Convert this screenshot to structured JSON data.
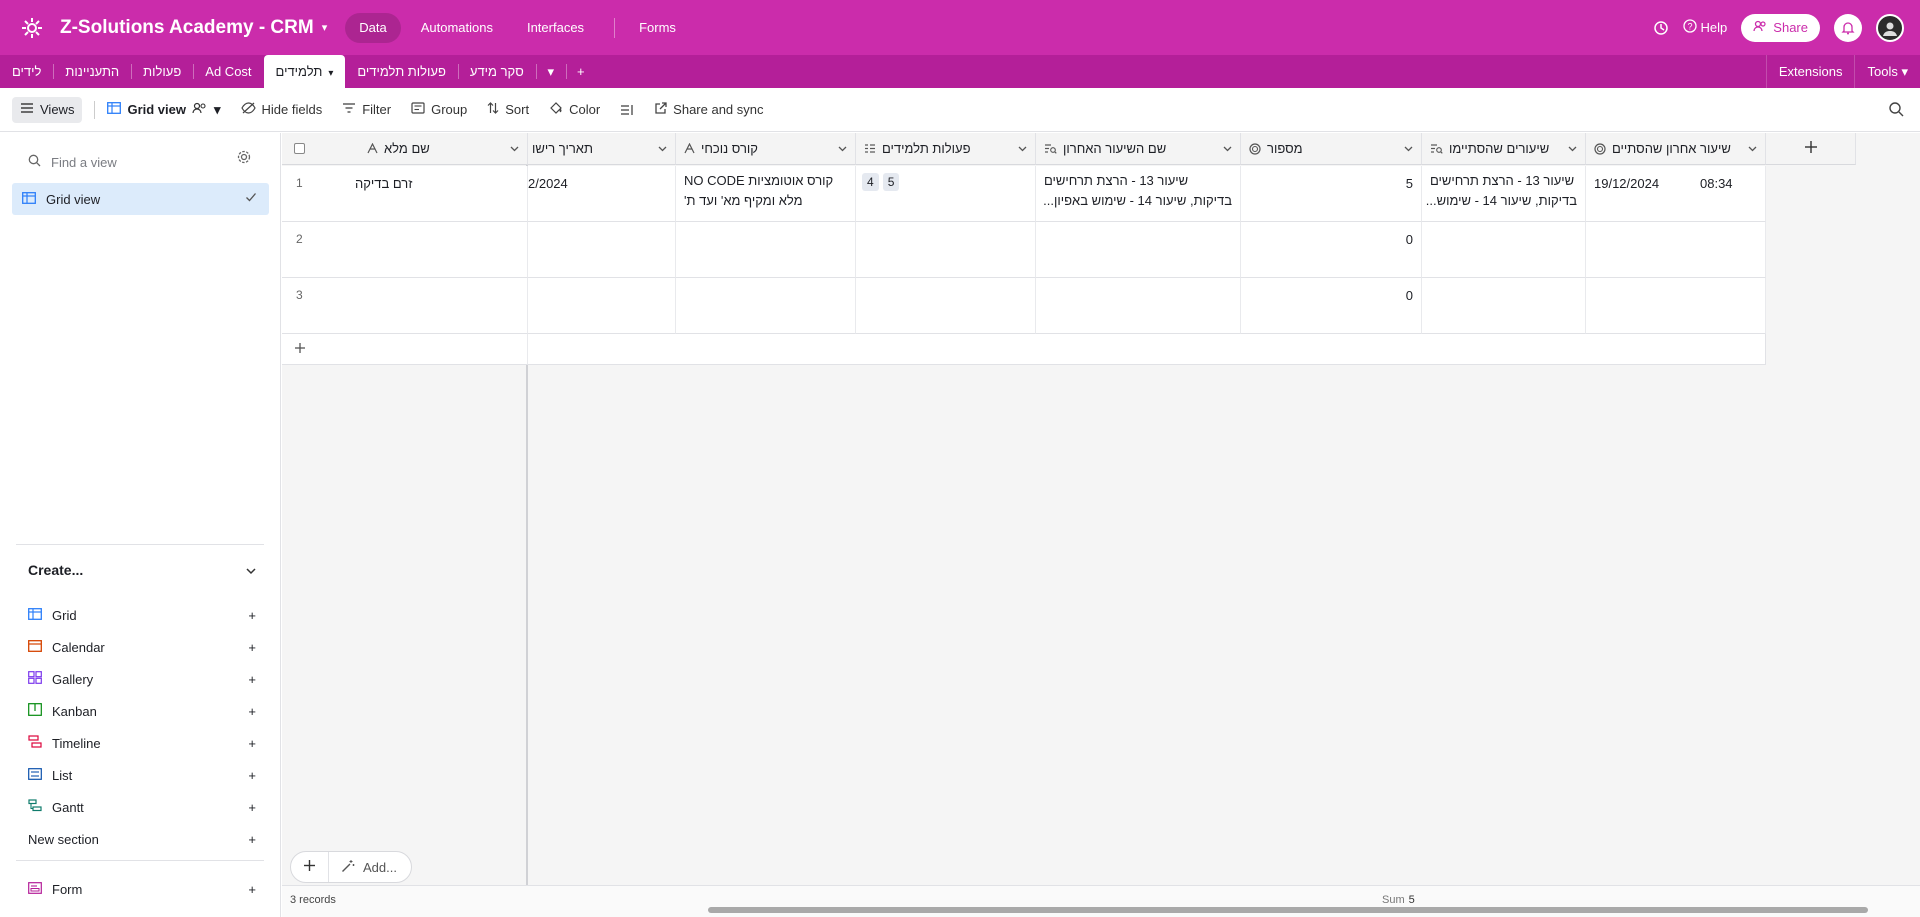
{
  "app": {
    "title": "Z-Solutions Academy - CRM",
    "nav": [
      "Data",
      "Automations",
      "Interfaces",
      "Forms"
    ],
    "help": "Help",
    "share": "Share",
    "accent_color": "#cb2cab"
  },
  "tables": {
    "items": [
      "לידים",
      "התעניינות",
      "פעולות",
      "Ad Cost",
      "תלמידים",
      "פעולות תלמידים",
      "סקר מידע"
    ],
    "extensions": "Extensions",
    "tools": "Tools"
  },
  "toolbar": {
    "views": "Views",
    "view_name": "Grid view",
    "hide_fields": "Hide fields",
    "filter": "Filter",
    "group": "Group",
    "sort": "Sort",
    "color": "Color",
    "share_sync": "Share and sync"
  },
  "sidebar": {
    "find_placeholder": "Find a view",
    "current_view": "Grid view",
    "create_label": "Create...",
    "create_items": [
      "Grid",
      "Calendar",
      "Gallery",
      "Kanban",
      "Timeline",
      "List",
      "Gantt",
      "New section"
    ],
    "form_label": "Form"
  },
  "grid": {
    "headers": [
      "שם מלא",
      "תאריך רישו",
      "קורס נוכחי",
      "פעולות תלמידים",
      "שם השיעור האחרון",
      "מספור",
      "שיעורים שהסתיימו",
      "שיעור אחרון שהסתיים"
    ],
    "rows": [
      {
        "num": "1",
        "name": "זרם בדיקה",
        "date": "2/2024",
        "course_1": "קורס אוטומציות NO CODE",
        "course_2": "מלא ומקיף מא' ועד ת'",
        "chip_1": "4",
        "chip_2": "5",
        "last_lesson_1": "שיעור 13 - הרצת תרחישים",
        "last_lesson_2": "בדיקות, שיעור 14 - שימוש באפיון...",
        "count": "5",
        "done_1": "שיעור 13 - הרצת תרחישים",
        "done_2": "בדיקות, שיעור 14 - שימוש...",
        "last_date": "19/12/2024",
        "last_time": "08:34"
      },
      {
        "num": "2",
        "count": "0"
      },
      {
        "num": "3",
        "count": "0"
      }
    ],
    "add_label": "Add...",
    "records": "3 records",
    "sum_label": "Sum",
    "sum_value": "5"
  }
}
